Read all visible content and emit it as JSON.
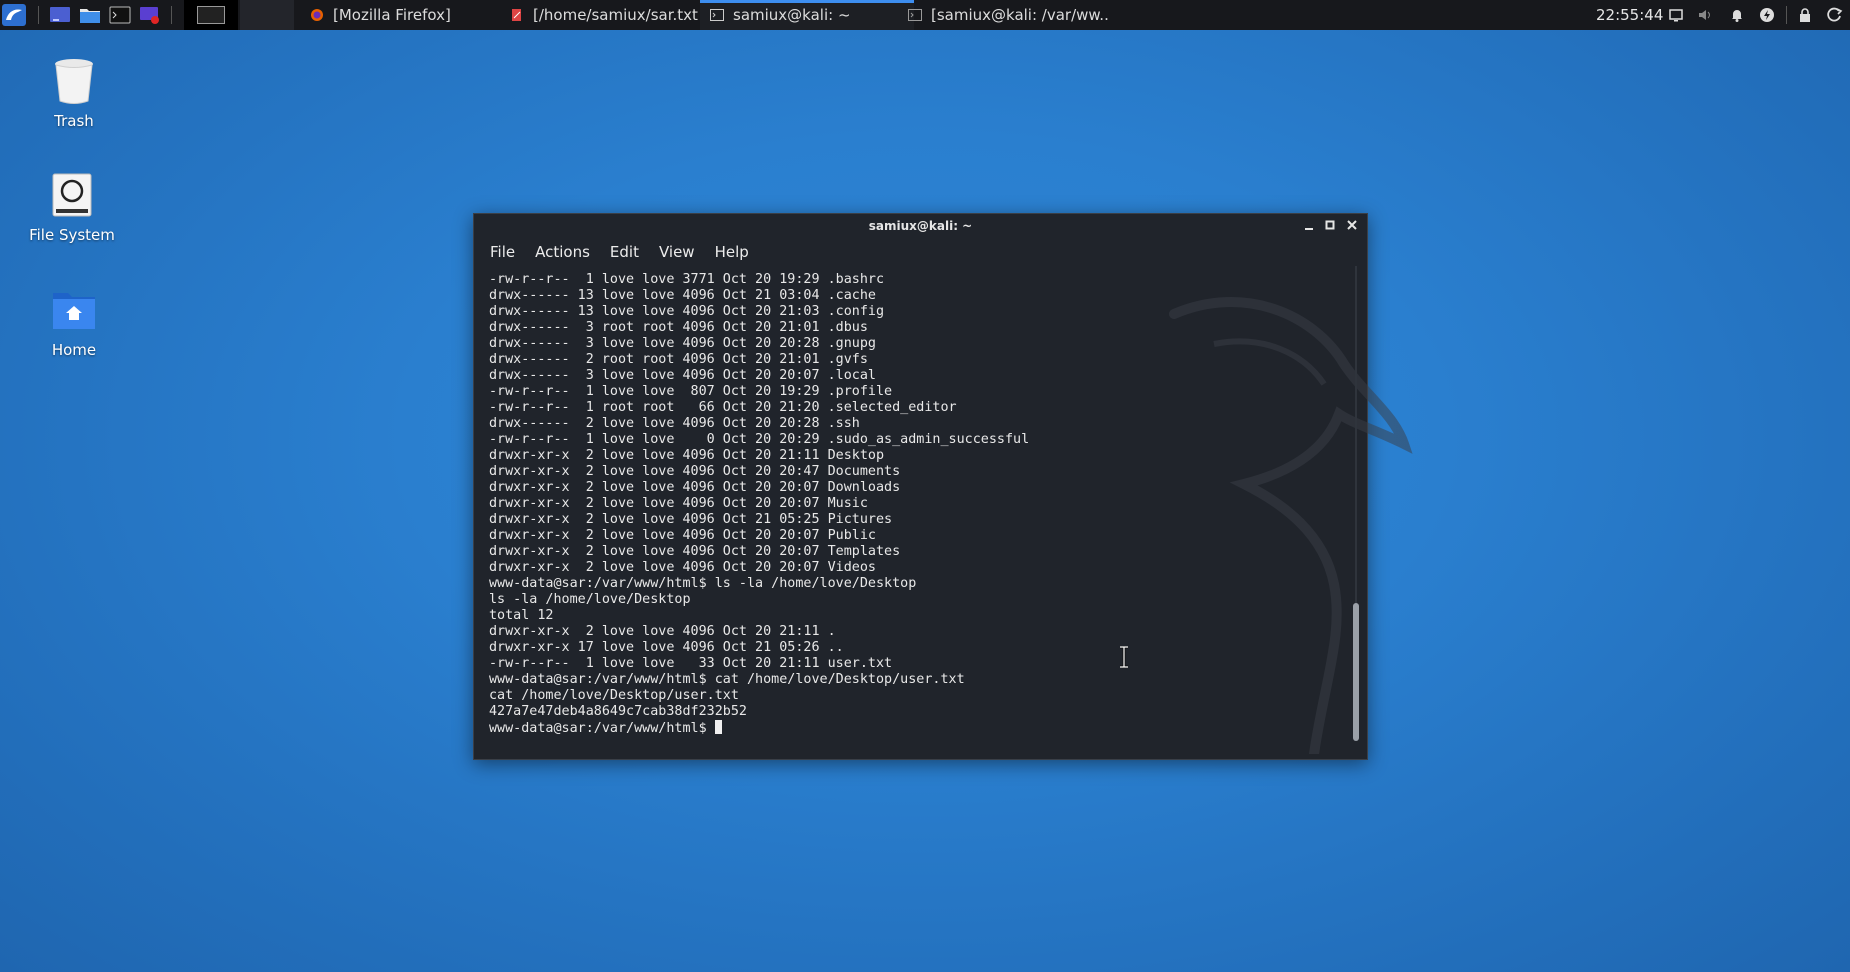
{
  "taskbar": {
    "tasks": [
      {
        "label": "[Mozilla Firefox]",
        "icon": "firefox-icon"
      },
      {
        "label": "[/home/samiux/sar.txt - ...",
        "icon": "text-editor-icon"
      },
      {
        "label": "samiux@kali: ~",
        "icon": "terminal-icon"
      },
      {
        "label": "[samiux@kali: /var/ww...",
        "icon": "terminal-icon"
      }
    ],
    "clock": "22:55:44"
  },
  "desktop": {
    "icons": [
      {
        "label": "Trash"
      },
      {
        "label": "File System"
      },
      {
        "label": "Home"
      }
    ]
  },
  "terminal": {
    "title": "samiux@kali: ~",
    "menu": [
      "File",
      "Actions",
      "Edit",
      "View",
      "Help"
    ],
    "lines": [
      "-rw-r--r--  1 love love 3771 Oct 20 19:29 .bashrc",
      "drwx------ 13 love love 4096 Oct 21 03:04 .cache",
      "drwx------ 13 love love 4096 Oct 20 21:03 .config",
      "drwx------  3 root root 4096 Oct 20 21:01 .dbus",
      "drwx------  3 love love 4096 Oct 20 20:28 .gnupg",
      "drwx------  2 root root 4096 Oct 20 21:01 .gvfs",
      "drwx------  3 love love 4096 Oct 20 20:07 .local",
      "-rw-r--r--  1 love love  807 Oct 20 19:29 .profile",
      "-rw-r--r--  1 root root   66 Oct 20 21:20 .selected_editor",
      "drwx------  2 love love 4096 Oct 20 20:28 .ssh",
      "-rw-r--r--  1 love love    0 Oct 20 20:29 .sudo_as_admin_successful",
      "drwxr-xr-x  2 love love 4096 Oct 20 21:11 Desktop",
      "drwxr-xr-x  2 love love 4096 Oct 20 20:47 Documents",
      "drwxr-xr-x  2 love love 4096 Oct 20 20:07 Downloads",
      "drwxr-xr-x  2 love love 4096 Oct 20 20:07 Music",
      "drwxr-xr-x  2 love love 4096 Oct 21 05:25 Pictures",
      "drwxr-xr-x  2 love love 4096 Oct 20 20:07 Public",
      "drwxr-xr-x  2 love love 4096 Oct 20 20:07 Templates",
      "drwxr-xr-x  2 love love 4096 Oct 20 20:07 Videos",
      "www-data@sar:/var/www/html$ ls -la /home/love/Desktop",
      "ls -la /home/love/Desktop",
      "total 12",
      "drwxr-xr-x  2 love love 4096 Oct 20 21:11 .",
      "drwxr-xr-x 17 love love 4096 Oct 21 05:26 ..",
      "-rw-r--r--  1 love love   33 Oct 20 21:11 user.txt",
      "www-data@sar:/var/www/html$ cat /home/love/Desktop/user.txt",
      "cat /home/love/Desktop/user.txt",
      "427a7e47deb4a8649c7cab38df232b52"
    ],
    "prompt": "www-data@sar:/var/www/html$ "
  },
  "colors": {
    "accent": "#3d8ef0",
    "terminal_bg": "#20242b",
    "taskbar_bg": "#17181c"
  }
}
